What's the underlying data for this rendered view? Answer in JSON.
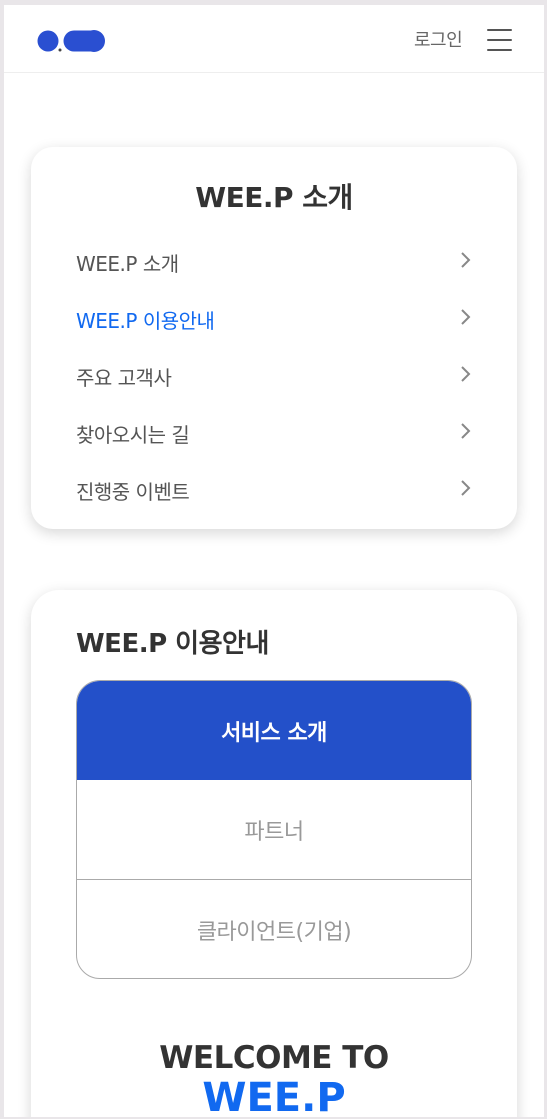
{
  "header": {
    "login_label": "로그인"
  },
  "icons": {
    "logo": "logo-dots",
    "menu": "hamburger-icon",
    "chevron": "chevron-right-icon"
  },
  "intro_menu": {
    "title": "WEE.P 소개",
    "items": [
      {
        "label": "WEE.P 소개",
        "active": false
      },
      {
        "label": "WEE.P 이용안내",
        "active": true
      },
      {
        "label": "주요 고객사",
        "active": false
      },
      {
        "label": "찾아오시는 길",
        "active": false
      },
      {
        "label": "진행중 이벤트",
        "active": false
      }
    ]
  },
  "guide": {
    "title": "WEE.P 이용안내",
    "tabs": [
      {
        "label": "서비스 소개",
        "selected": true
      },
      {
        "label": "파트너",
        "selected": false
      },
      {
        "label": "클라이언트(기업)",
        "selected": false
      }
    ],
    "welcome_line": "WELCOME TO",
    "brand_line": "WEE.P"
  },
  "colors": {
    "accent": "#1169f0",
    "tab_active_bg": "#2350c9",
    "logo_blue": "#2a4fd1"
  }
}
